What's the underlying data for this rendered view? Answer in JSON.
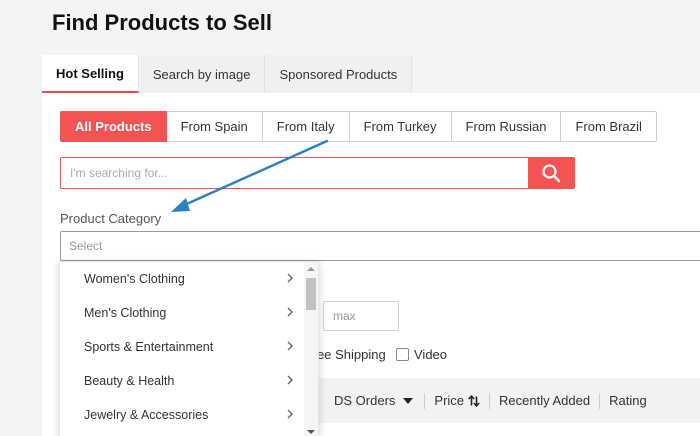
{
  "page": {
    "title": "Find Products to Sell"
  },
  "tabs": [
    {
      "label": "Hot Selling",
      "active": true
    },
    {
      "label": "Search by image",
      "active": false
    },
    {
      "label": "Sponsored Products",
      "active": false
    }
  ],
  "filters": [
    {
      "label": "All Products",
      "active": true
    },
    {
      "label": "From Spain",
      "active": false
    },
    {
      "label": "From Italy",
      "active": false
    },
    {
      "label": "From Turkey",
      "active": false
    },
    {
      "label": "From Russian",
      "active": false
    },
    {
      "label": "From Brazil",
      "active": false
    }
  ],
  "search": {
    "placeholder": "I'm searching for..."
  },
  "category": {
    "label": "Product Category",
    "select_placeholder": "Select",
    "options": [
      "Women's Clothing",
      "Men's Clothing",
      "Sports & Entertainment",
      "Beauty & Health",
      "Jewelry & Accessories"
    ]
  },
  "price": {
    "dash": "-",
    "max_placeholder": "max"
  },
  "shipping": {
    "free_shipping_partial": "ee Shipping",
    "video_label": "Video"
  },
  "sort": {
    "ds_orders": "DS Orders",
    "price": "Price",
    "recently_added": "Recently Added",
    "rating": "Rating"
  },
  "colors": {
    "accent": "#f35353",
    "annotation_arrow": "#2b7fc4"
  }
}
